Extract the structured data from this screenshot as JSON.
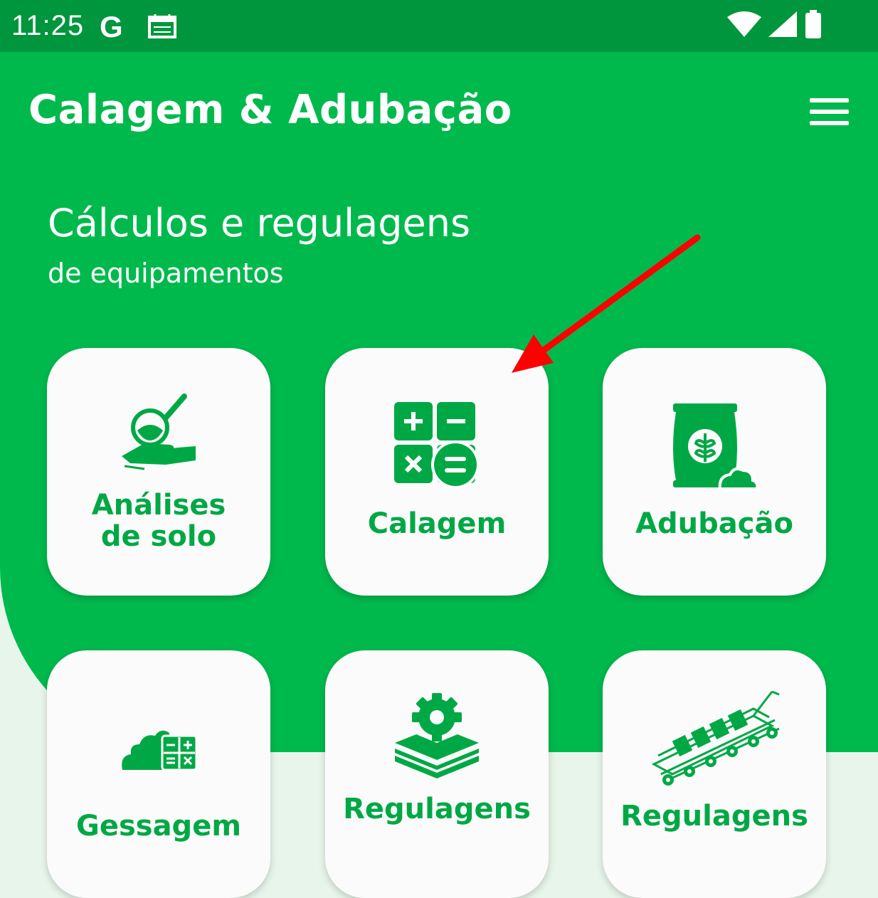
{
  "status_bar": {
    "time": "11:25",
    "g_label": "G"
  },
  "app_bar": {
    "title": "Calagem & Adubação"
  },
  "header": {
    "title": "Cálculos e regulagens",
    "subtitle": "de equipamentos"
  },
  "cards": [
    {
      "label_line1": "Análises",
      "label_line2": "de solo",
      "icon": "soil-analysis-icon"
    },
    {
      "label": "Calagem",
      "icon": "calculator-icon"
    },
    {
      "label": "Adubação",
      "icon": "fertilizer-bag-icon"
    },
    {
      "label": "Gessagem",
      "icon": "gypsum-calc-icon"
    },
    {
      "label": "Regulagens",
      "icon": "gear-layers-icon"
    },
    {
      "label": "Regulagens",
      "icon": "seeder-machine-icon"
    }
  ],
  "colors": {
    "primary": "#00b94d",
    "status_bar": "#00963d",
    "accent_text": "#00a845",
    "card_bg": "#fbfbfb",
    "page_bg": "#e8f5ea",
    "annotation_arrow": "#ff0000"
  }
}
